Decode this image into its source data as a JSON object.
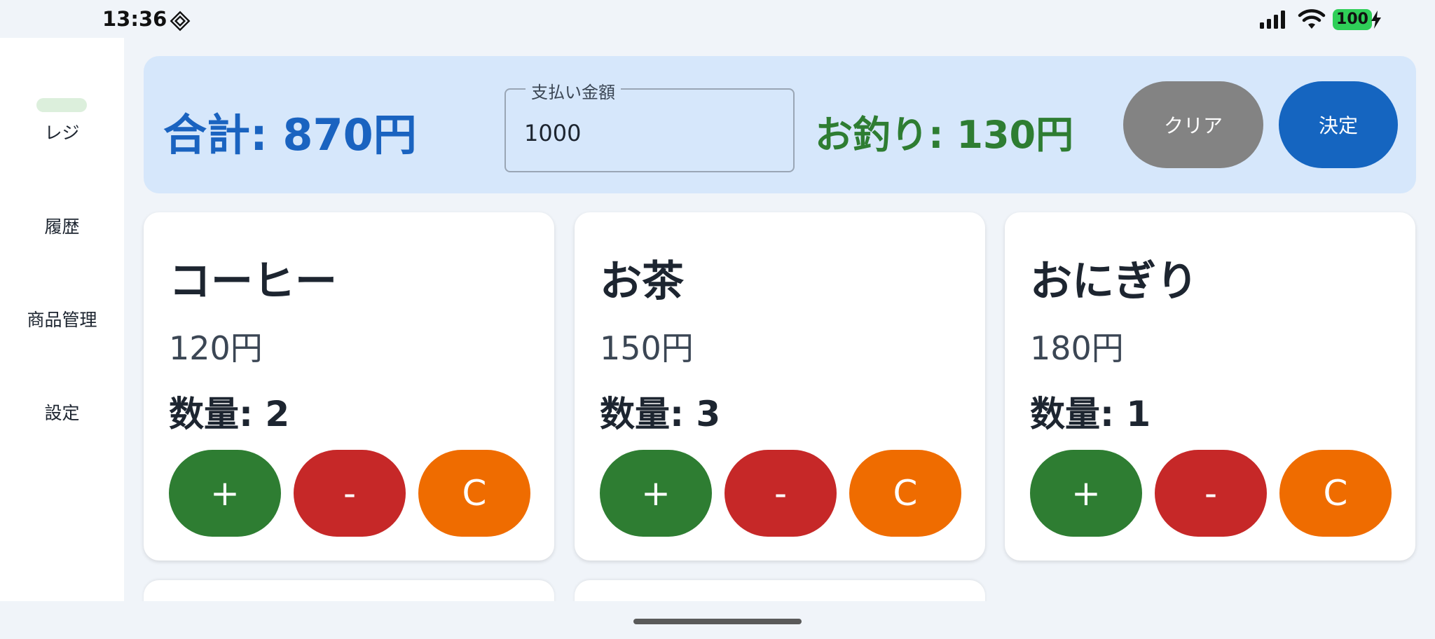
{
  "status": {
    "time": "13:36",
    "battery": "100"
  },
  "sidebar": {
    "items": [
      {
        "label": "レジ"
      },
      {
        "label": "履歴"
      },
      {
        "label": "商品管理"
      },
      {
        "label": "設定"
      }
    ]
  },
  "header": {
    "total": "合計: 870円",
    "payment_label": "支払い金額",
    "payment_value": "1000",
    "change": "お釣り: 130円",
    "clear_label": "クリア",
    "confirm_label": "決定"
  },
  "products": [
    {
      "name": "コーヒー",
      "price": "120円",
      "quantity": "数量: 2"
    },
    {
      "name": "お茶",
      "price": "150円",
      "quantity": "数量: 3"
    },
    {
      "name": "おにぎり",
      "price": "180円",
      "quantity": "数量: 1"
    }
  ],
  "qty_buttons": {
    "plus": "+",
    "minus": "-",
    "clear": "C"
  },
  "colors": {
    "primary": "#1565c0",
    "success": "#2e7d32",
    "danger": "#c62828",
    "warning": "#ef6c00",
    "neutral": "#838383",
    "header_bg": "#d6e7fb"
  }
}
